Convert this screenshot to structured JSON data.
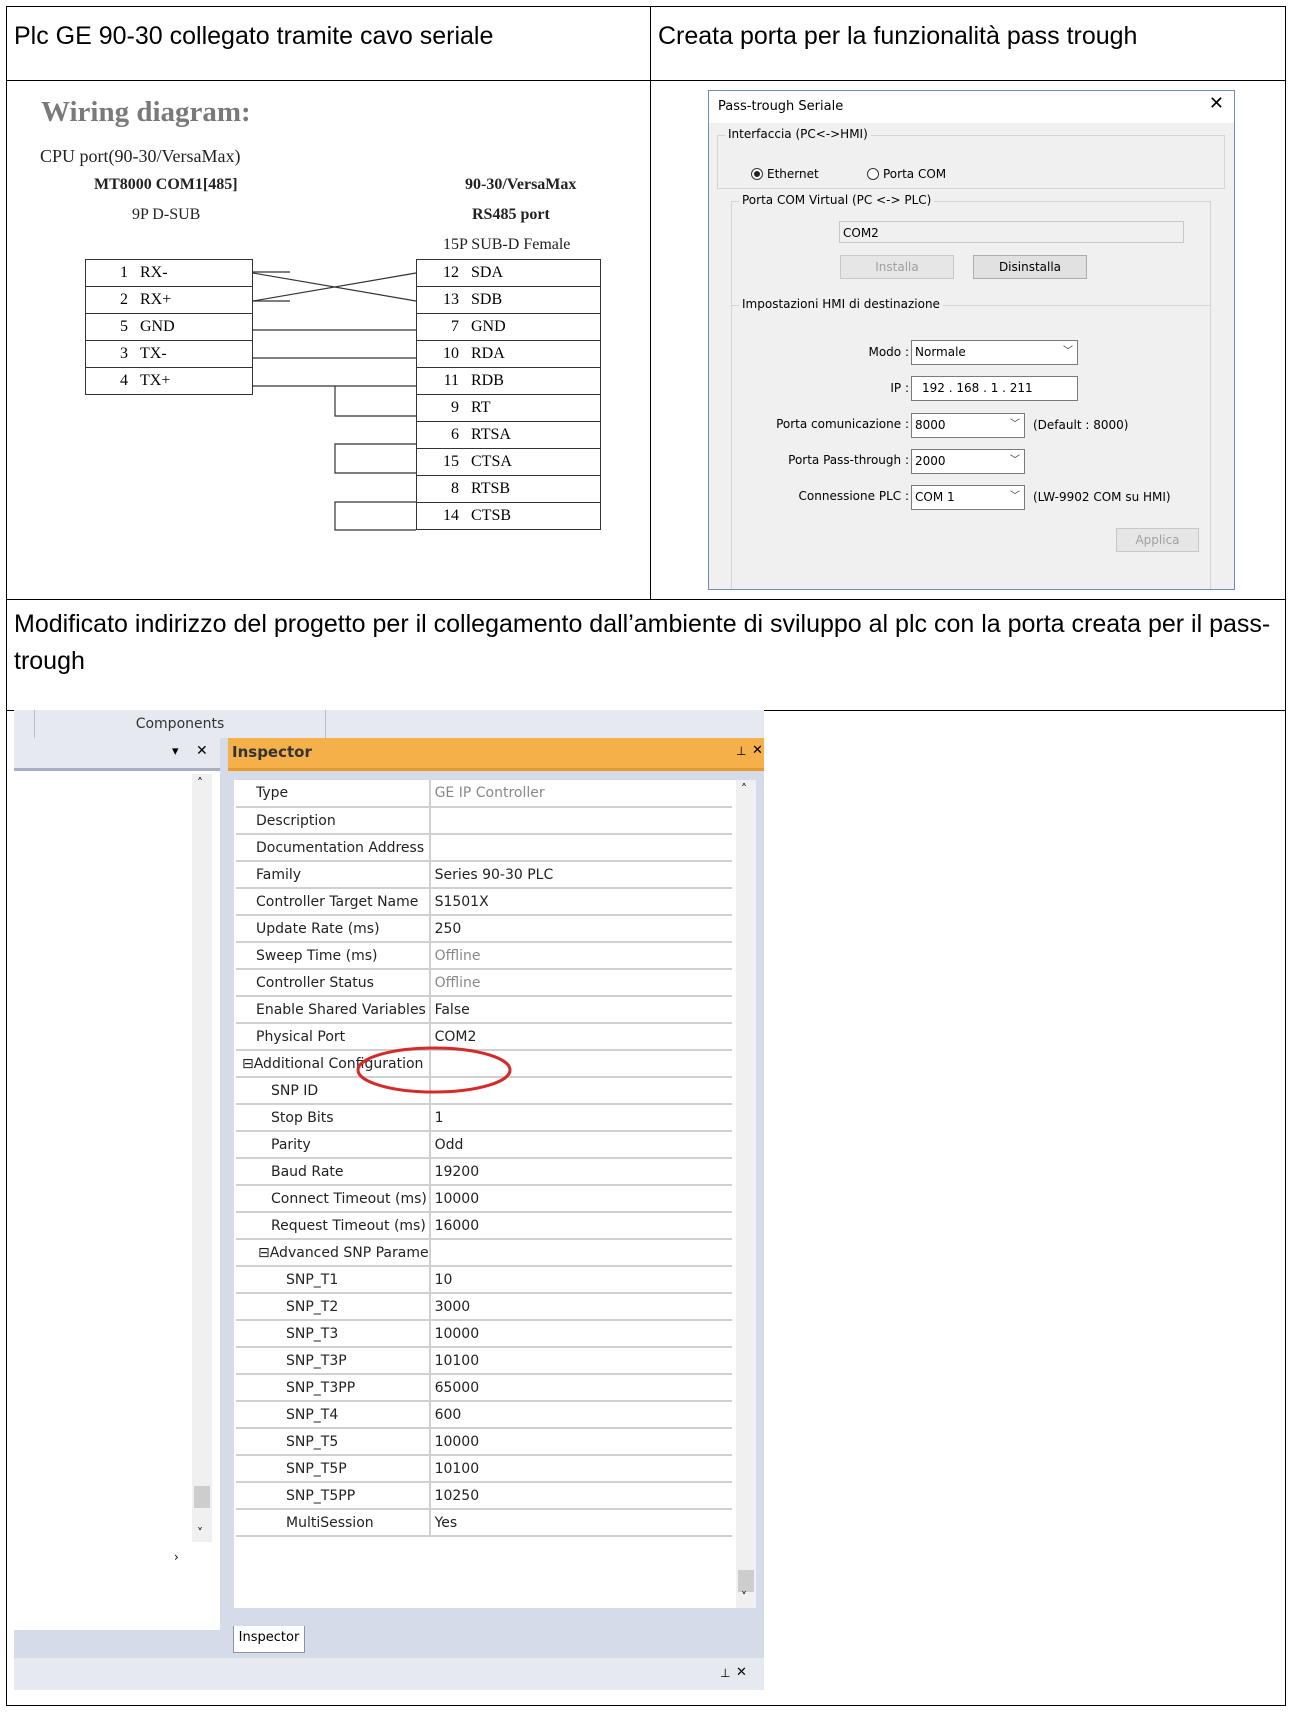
{
  "cells": {
    "top_left_title": "Plc GE 90-30 collegato tramite cavo seriale",
    "top_right_title": "Creata porta per la funzionalità pass trough",
    "middle_text": "Modificato indirizzo del progetto per il collegamento dall’ambiente di sviluppo al plc con la porta creata per il pass-trough"
  },
  "wiring": {
    "title": "Wiring diagram:",
    "subtitle": "CPU port(90-30/VersaMax)",
    "left_header1": "MT8000 COM1[485]",
    "left_header2": "9P D-SUB",
    "right_header1": "90-30/VersaMax",
    "right_header2": "RS485 port",
    "right_header3": "15P SUB-D Female",
    "left_pins": [
      {
        "num": "1",
        "sig": "RX-"
      },
      {
        "num": "2",
        "sig": "RX+"
      },
      {
        "num": "5",
        "sig": "GND"
      },
      {
        "num": "3",
        "sig": "TX-"
      },
      {
        "num": "4",
        "sig": "TX+"
      }
    ],
    "right_pins": [
      {
        "num": "12",
        "sig": "SDA"
      },
      {
        "num": "13",
        "sig": "SDB"
      },
      {
        "num": "7",
        "sig": "GND"
      },
      {
        "num": "10",
        "sig": "RDA"
      },
      {
        "num": "11",
        "sig": "RDB"
      },
      {
        "num": "9",
        "sig": "RT"
      },
      {
        "num": "6",
        "sig": "RTSA"
      },
      {
        "num": "15",
        "sig": "CTSA"
      },
      {
        "num": "8",
        "sig": "RTSB"
      },
      {
        "num": "14",
        "sig": "CTSB"
      }
    ]
  },
  "dialog": {
    "title": "Pass-trough Seriale",
    "close_glyph": "✕",
    "group1_label": "Interfaccia (PC<->HMI)",
    "radio_ethernet": "Ethernet",
    "radio_com": "Porta COM",
    "group2_label": "Porta COM Virtual (PC <-> PLC)",
    "com_value": "COM2",
    "btn_install": "Installa",
    "btn_uninstall": "Disinstalla",
    "group3_label": "Impostazioni HMI di destinazione",
    "modo_label": "Modo :",
    "modo_value": "Normale",
    "ip_label": "IP :",
    "ip_value": "192 . 168 .  1  . 211",
    "porta_com_label": "Porta comunicazione :",
    "porta_com_value": "8000",
    "porta_com_default": "(Default : 8000)",
    "porta_pass_label": "Porta Pass-through :",
    "porta_pass_value": "2000",
    "conn_plc_label": "Connessione PLC :",
    "conn_plc_value": "COM 1",
    "conn_plc_note": "(LW-9902 COM su HMI)",
    "btn_apply": "Applica"
  },
  "ide": {
    "components_tab": "Components",
    "inspector_title": "Inspector",
    "inspector_tab": "Inspector",
    "pin_glyph": "⊥",
    "close_glyph": "✕",
    "rows": [
      {
        "key": "Type",
        "value": "GE IP Controller",
        "indent": 0,
        "gray": true
      },
      {
        "key": "Description",
        "value": "",
        "indent": 0
      },
      {
        "key": "Documentation Address",
        "value": "",
        "indent": 0
      },
      {
        "key": "Family",
        "value": "Series 90-30 PLC",
        "indent": 0
      },
      {
        "key": "Controller Target Name",
        "value": "S1501X",
        "indent": 0
      },
      {
        "key": "Update Rate (ms)",
        "value": "250",
        "indent": 0
      },
      {
        "key": "Sweep Time (ms)",
        "value": "Offline",
        "indent": 0,
        "gray": true
      },
      {
        "key": "Controller Status",
        "value": "Offline",
        "indent": 0,
        "gray": true
      },
      {
        "key": "Enable Shared Variables",
        "value": "False",
        "indent": 0
      },
      {
        "key": "Physical Port",
        "value": "COM2",
        "indent": 0,
        "highlight": true
      },
      {
        "key": "⊟Additional Configuration",
        "value": "",
        "indent": -1
      },
      {
        "key": "SNP ID",
        "value": "",
        "indent": 1
      },
      {
        "key": "Stop Bits",
        "value": "1",
        "indent": 1
      },
      {
        "key": "Parity",
        "value": "Odd",
        "indent": 1
      },
      {
        "key": "Baud Rate",
        "value": "19200",
        "indent": 1
      },
      {
        "key": "Connect Timeout (ms)",
        "value": "10000",
        "indent": 1
      },
      {
        "key": "Request Timeout (ms)",
        "value": "16000",
        "indent": 1
      },
      {
        "key": "⊟Advanced SNP Parame",
        "value": "",
        "indent": 2
      },
      {
        "key": "SNP_T1",
        "value": "10",
        "indent": 3
      },
      {
        "key": "SNP_T2",
        "value": "3000",
        "indent": 3
      },
      {
        "key": "SNP_T3",
        "value": "10000",
        "indent": 3
      },
      {
        "key": "SNP_T3P",
        "value": "10100",
        "indent": 3
      },
      {
        "key": "SNP_T3PP",
        "value": "65000",
        "indent": 3
      },
      {
        "key": "SNP_T4",
        "value": "600",
        "indent": 3
      },
      {
        "key": "SNP_T5",
        "value": "10000",
        "indent": 3
      },
      {
        "key": "SNP_T5P",
        "value": "10100",
        "indent": 3
      },
      {
        "key": "SNP_T5PP",
        "value": "10250",
        "indent": 3
      },
      {
        "key": "MultiSession",
        "value": "Yes",
        "indent": 3
      }
    ]
  }
}
